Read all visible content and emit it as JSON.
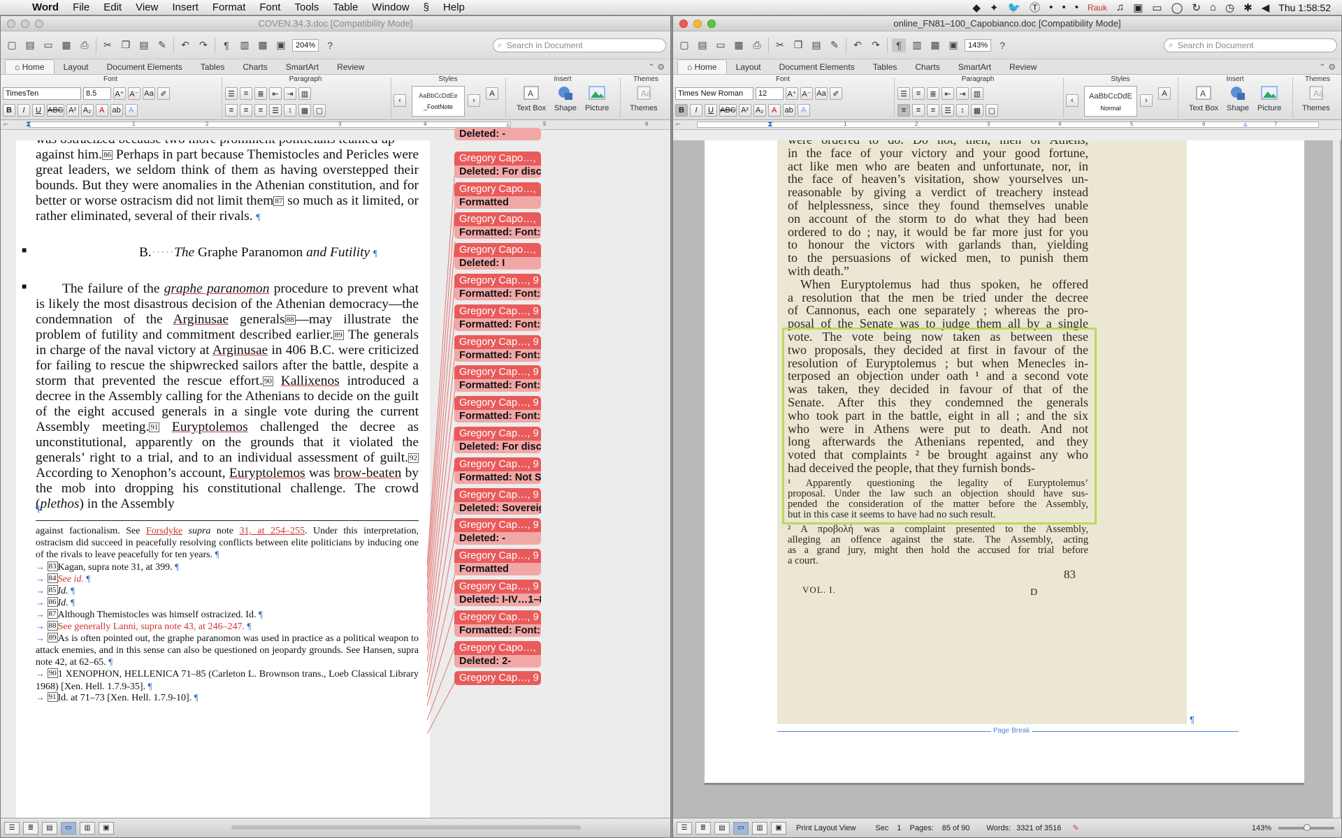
{
  "menubar": {
    "apple": "",
    "items": [
      "Word",
      "File",
      "Edit",
      "View",
      "Insert",
      "Format",
      "Font",
      "Tools",
      "Table",
      "Window",
      "",
      "Help"
    ],
    "clock": "Thu 1:58:52",
    "rauk": "Rauk"
  },
  "left": {
    "title": "COVEN.34.3.doc [Compatibility Mode]",
    "zoom": "204%",
    "search_placeholder": "Search in Document",
    "tabs": [
      "Home",
      "Layout",
      "Document Elements",
      "Tables",
      "Charts",
      "SmartArt",
      "Review"
    ],
    "groups": {
      "font": "Font",
      "paragraph": "Paragraph",
      "styles": "Styles",
      "insert": "Insert",
      "themes": "Themes"
    },
    "font_name": "TimesTen",
    "font_size": "8.5",
    "style_preview": "AaBbCcDdEe",
    "style_name": "_FootNote",
    "insert_text_box": "Text Box",
    "insert_shape": "Shape",
    "insert_picture": "Picture",
    "themes_label": "Themes",
    "ruler_ticks": [
      "1",
      "2",
      "3",
      "4",
      "5",
      "6"
    ],
    "body": {
      "p0": "was ostracized because two more prominent politicians teamed up",
      "p1_a": "against him.",
      "p1_fn86": "86",
      "p1_b": " Perhaps in part because Themistocles and Pericles were great leaders, we seldom think of them as having overstepped their bounds. But they were anomalies in the Athenian constitution, and for better or worse ostracism did not limit them",
      "p1_fn87": "87",
      "p1_c": " so much as it limited, or rather eliminated, several of their rivals.",
      "heading_letter": "B.",
      "heading_a": "The",
      "heading_b": " Graphe Paranomon ",
      "heading_c": "and Futility",
      "p2_a": "The failure of the ",
      "p2_gp": "graphe paranomon",
      "p2_b": " procedure to prevent what is likely the most disastrous decision of the Athenian democracy—the condemnation of the ",
      "p2_arg": "Arginusae",
      "p2_c": " generals",
      "p2_fn88": "88",
      "p2_d": "—may illustrate the problem of futility and commitment described earlier.",
      "p2_fn89": "89",
      "p2_e": " The generals in charge of the naval victory at ",
      "p2_arg2": "Arginusae",
      "p2_f": " in 406 B.C. were criticized for failing to rescue the shipwrecked sailors after the battle, despite a storm that prevented the rescue effort.",
      "p2_fn90": "90",
      "p2_kal": "Kallixenos",
      "p2_g": " introduced a decree in the Assembly calling for the Athenians to decide on the guilt of the eight accused generals in a single vote during the current Assembly meeting.",
      "p2_fn91": "91",
      "p2_eur": "Euryptolemos",
      "p2_h": " challenged the decree as unconstitutional, apparently on the grounds that it violated the generals’ right to a trial, and to an individual assessment of guilt.",
      "p2_fn92": "92",
      "p2_i": " According to Xenophon’s account, ",
      "p2_eur2": "Euryptolemos",
      "p2_j": " was ",
      "p2_bb": "brow-beaten",
      "p2_k": " by the mob into dropping his constitutional challenge. The crowd (",
      "p2_pl": "plethos",
      "p2_l": ") in the Assembly"
    },
    "footnotes": {
      "cont_a": "against factionalism. See ",
      "cont_for": "Forsdyke",
      "cont_b": " supra",
      "cont_c": " note ",
      "cont_d": "31, at 254–255",
      "cont_e": ". Under this interpretation, ostracism did succeed in peacefully resolving conflicts between elite politicians by inducing one of the rivals to leave peacefully for ten years.",
      "fn83_num": "83",
      "fn83": "Kagan, supra note 31, at 399.",
      "fn84_num": "84",
      "fn84": "See id.",
      "fn85_num": "85",
      "fn85": "Id.",
      "fn86_num": "86",
      "fn86": "Id.",
      "fn87_num": "87",
      "fn87": "Although Themistocles was himself ostracized. Id.",
      "fn88_num": "88",
      "fn88": "See generally Lanni, supra note 43, at 246–247.",
      "fn89_num": "89",
      "fn89": "As is often pointed out, the graphe paranomon was used in practice as a political weapon to attack enemies, and in this sense can also be questioned on jeopardy grounds. See Hansen, supra note 42, at 62–65.",
      "fn90_num": "90",
      "fn90": "1 XENOPHON, HELLENICA 71–85 (Carleton L. Brownson trans., Loeb Classical Library 1968) [Xen. Hell. 1.7.9-35].",
      "fn91_num": "91",
      "fn91": "Id. at 71–73 [Xen. Hell. 1.7.9-10]."
    },
    "comments": [
      {
        "head": "",
        "body": "Deleted: -"
      },
      {
        "head": "Gregory Capo…,",
        "body": "Deleted: For discuss"
      },
      {
        "head": "Gregory Capo…,",
        "body": "Formatted"
      },
      {
        "head": "Gregory Capo…,",
        "body": "Formatted: Font:"
      },
      {
        "head": "Gregory Capo…,",
        "body": "Deleted: I"
      },
      {
        "head": "Gregory Cap…, 9",
        "body": "Formatted: Font:"
      },
      {
        "head": "Gregory Cap…, 9",
        "body": "Formatted: Font:"
      },
      {
        "head": "Gregory Cap…, 9",
        "body": "Formatted: Font:"
      },
      {
        "head": "Gregory Cap…, 9",
        "body": "Formatted: Font:"
      },
      {
        "head": "Gregory Cap…, 9",
        "body": "Formatted: Font:"
      },
      {
        "head": "Gregory Cap…, 9",
        "body": "Deleted: For discus"
      },
      {
        "head": "Gregory Cap…, 9",
        "body": "Formatted: Not S"
      },
      {
        "head": "Gregory Cap…, 9",
        "body": "Deleted: Sovereignt"
      },
      {
        "head": "Gregory Cap…, 9",
        "body": "Deleted: -"
      },
      {
        "head": "Gregory Cap…, 9",
        "body": "Formatted"
      },
      {
        "head": "Gregory Cap…, 9",
        "body": "Deleted: I-IV…1–8"
      },
      {
        "head": "Gregory Cap…, 9",
        "body": "Formatted: Font:"
      },
      {
        "head": "Gregory Capo…,",
        "body": "Deleted: 2-"
      },
      {
        "head": "Gregory Cap…, 9",
        "body": ""
      }
    ]
  },
  "right": {
    "title": "online_FN81–100_Capobianco.doc [Compatibility Mode]",
    "zoom": "143%",
    "search_placeholder": "Search in Document",
    "tabs": [
      "Home",
      "Layout",
      "Document Elements",
      "Tables",
      "Charts",
      "SmartArt",
      "Review"
    ],
    "groups": {
      "font": "Font",
      "paragraph": "Paragraph",
      "styles": "Styles",
      "insert": "Insert",
      "themes": "Themes"
    },
    "font_name": "Times New Roman",
    "font_size": "12",
    "style_preview": "AaBbCcDdE",
    "style_name": "Normal",
    "insert_text_box": "Text Box",
    "insert_shape": "Shape",
    "insert_picture": "Picture",
    "themes_label": "Themes",
    "ruler_ticks": [
      "1",
      "2",
      "3",
      "4",
      "5",
      "6",
      "7"
    ],
    "scan_lines": [
      "were ordered to do. Do not, then, men of Athens,",
      "in the face of your victory and your good fortune,",
      "act like men who are beaten and unfortunate, nor, in",
      "the face of heaven’s visitation, show yourselves un-",
      "reasonable by giving a verdict of treachery instead",
      "of helplessness, since they found themselves unable",
      "on account of the storm to do what they had been",
      "ordered to do ; nay, it would be far more just for you",
      "to honour the victors with garlands than, yielding",
      "to the persuasions of wicked men, to punish them",
      "with death.”",
      "When Euryptolemus had thus spoken, he offered",
      "a resolution that the men be tried under the decree",
      "of Cannonus, each one separately ; whereas the pro-",
      "posal of the Senate was to judge them all by a single",
      "vote. The vote being now taken as between these",
      "two proposals, they decided at first in favour of the",
      "resolution of Euryptolemus ; but when Menecles in-",
      "terposed an objection under oath ¹ and a second vote",
      "was taken, they decided in favour of that of the",
      "Senate. After this they condemned the generals",
      "who took part in the battle, eight in all ; and the six",
      "who were in Athens were put to death. And not",
      "long afterwards the Athenians repented, and they",
      "voted that complaints ² be brought against any who",
      "had deceived the people, that they furnish bonds-"
    ],
    "scan_notes": [
      "¹ Apparently questioning the legality of Euryptolemus’",
      "proposal. Under the law such an objection should have sus-",
      "pended the consideration of the matter before the Assembly,",
      "but in this case it seems to have had no such result.",
      "² A προβολή was a complaint presented to the Assembly,",
      "alleging an offence against the state. The Assembly, acting",
      "as a grand jury, might then hold the accused for trial before",
      "a court."
    ],
    "page_number": "83",
    "vol": "VOL. I.",
    "signature": "D",
    "page_break": "Page Break",
    "status": {
      "view": "Print Layout View",
      "sec_label": "Sec",
      "sec": "1",
      "pages_label": "Pages:",
      "pages": "85 of 90",
      "words_label": "Words:",
      "words": "3321 of 3516",
      "zoom": "143%"
    }
  }
}
